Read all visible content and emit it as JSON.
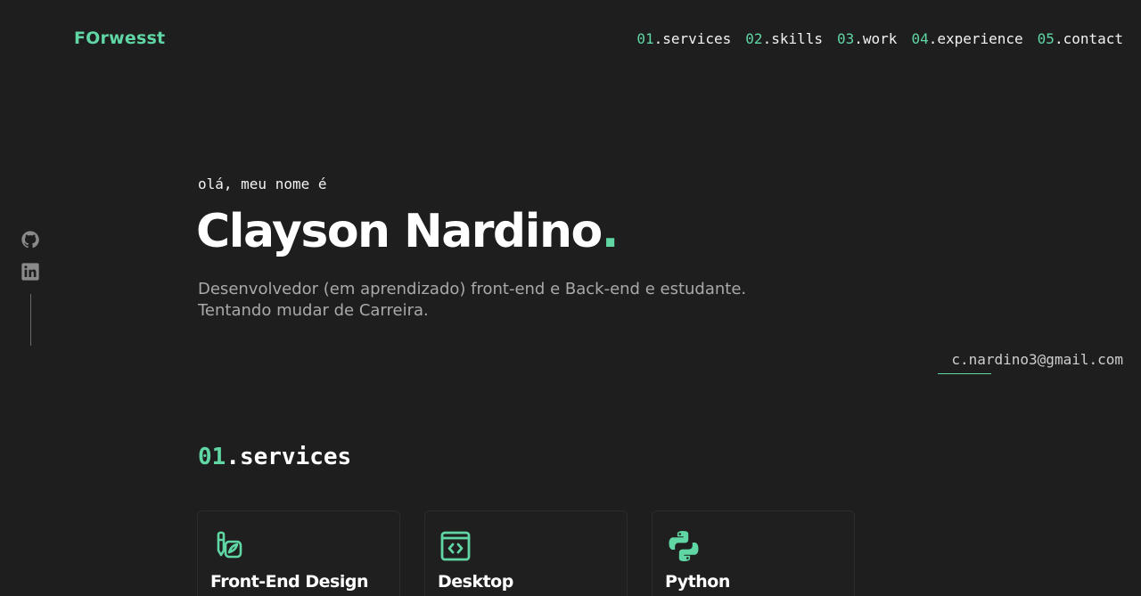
{
  "header": {
    "logo": "FOrwesst",
    "nav": [
      {
        "num": "01",
        "label": ".services"
      },
      {
        "num": "02",
        "label": ".skills"
      },
      {
        "num": "03",
        "label": ".work"
      },
      {
        "num": "04",
        "label": ".experience"
      },
      {
        "num": "05",
        "label": ".contact"
      }
    ]
  },
  "social": {
    "icons": [
      "github-icon",
      "linkedin-icon"
    ]
  },
  "hero": {
    "greeting": "olá, meu nome é",
    "name": "Clayson Nardino",
    "name_dot": ".",
    "tagline_line1": "Desenvolvedor (em aprendizado) front-end e Back-end e estudante.",
    "tagline_line2": "Tentando mudar de Carreira."
  },
  "contact": {
    "email": "c.nardino3@gmail.com"
  },
  "services": {
    "num": "01",
    "title": ".services",
    "cards": [
      {
        "icon": "design-tools-icon",
        "title": "Front-End Design"
      },
      {
        "icon": "code-icon",
        "title": "Desktop"
      },
      {
        "icon": "python-icon",
        "title": "Python"
      }
    ]
  },
  "colors": {
    "background": "#1e1e1e",
    "accent": "#5fd6a4",
    "text": "#f2f2f2",
    "muted": "#a9a9a9"
  }
}
